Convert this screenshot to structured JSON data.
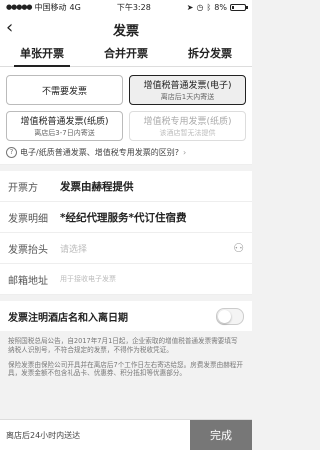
{
  "statusbar": {
    "carrier": "中国移动",
    "network": "4G",
    "time": "下午3:28",
    "battery": "8%"
  },
  "nav": {
    "title": "发票",
    "back_icon": "chevron-left-icon"
  },
  "tabs": [
    {
      "label": "单张开票"
    },
    {
      "label": "合并开票"
    },
    {
      "label": "拆分发票"
    }
  ],
  "options": [
    {
      "title": "不需要发票",
      "sub": ""
    },
    {
      "title": "增值税普通发票(电子)",
      "sub": "离店后1天内寄送"
    },
    {
      "title": "增值税普通发票(纸质)",
      "sub": "离店后3-7日内寄送"
    },
    {
      "title": "增值税专用发票(纸质)",
      "sub": "该酒店暂无法提供"
    }
  ],
  "question": {
    "text": "电子/纸质普通发票、增值税专用发票的区别?",
    "arrow": "›"
  },
  "form": {
    "issuer_label": "开票方",
    "issuer_value": "发票由赫程提供",
    "detail_label": "发票明细",
    "detail_value": "*经纪代理服务*代订住宿费",
    "title_label": "发票抬头",
    "title_placeholder": "请选择",
    "email_label": "邮箱地址",
    "email_placeholder": "用于接收电子发票"
  },
  "toggle": {
    "label": "发票注明酒店名和入离日期",
    "on": false
  },
  "notes": [
    "按照国税总局公告，自2017年7月1日起，企业索取的增值税普通发票需要填写纳税人识别号，不符合规定的发票，不得作为税收凭证。",
    "保险发票由保险公司开具并在离店后7个工作日左右寄达给您。房费发票由赫程开具，发票金额不包含礼品卡、优惠券、积分抵扣等优惠部分。"
  ],
  "bottom": {
    "info": "离店后24小时内送达",
    "done_label": "完成"
  }
}
